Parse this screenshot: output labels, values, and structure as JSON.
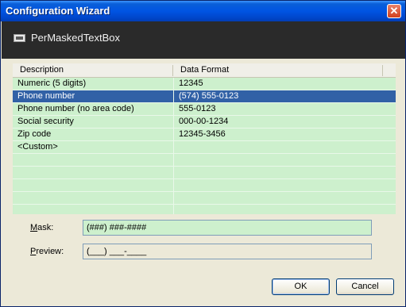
{
  "window": {
    "title": "Configuration Wizard",
    "close_glyph": "✕"
  },
  "header": {
    "title": "PerMaskedTextBox",
    "icon": "masked-textbox-icon"
  },
  "grid": {
    "columns": [
      "Description",
      "Data Format"
    ],
    "rows": [
      {
        "description": "Numeric (5 digits)",
        "format": "12345"
      },
      {
        "description": "Phone number",
        "format": "(574) 555-0123",
        "selected": true
      },
      {
        "description": "Phone number (no area code)",
        "format": "555-0123"
      },
      {
        "description": "Social security",
        "format": "000-00-1234"
      },
      {
        "description": "Zip code",
        "format": "12345-3456"
      },
      {
        "description": "<Custom>",
        "format": ""
      }
    ],
    "colors": {
      "background": "#cdf0cd",
      "selected": "#3161a6"
    }
  },
  "mask": {
    "label_accel": "M",
    "label_rest": "ask:",
    "value": "(###) ###-####"
  },
  "preview": {
    "label_accel": "P",
    "label_rest": "review:",
    "value": "(___) ___-____"
  },
  "buttons": {
    "ok": "OK",
    "cancel": "Cancel"
  }
}
